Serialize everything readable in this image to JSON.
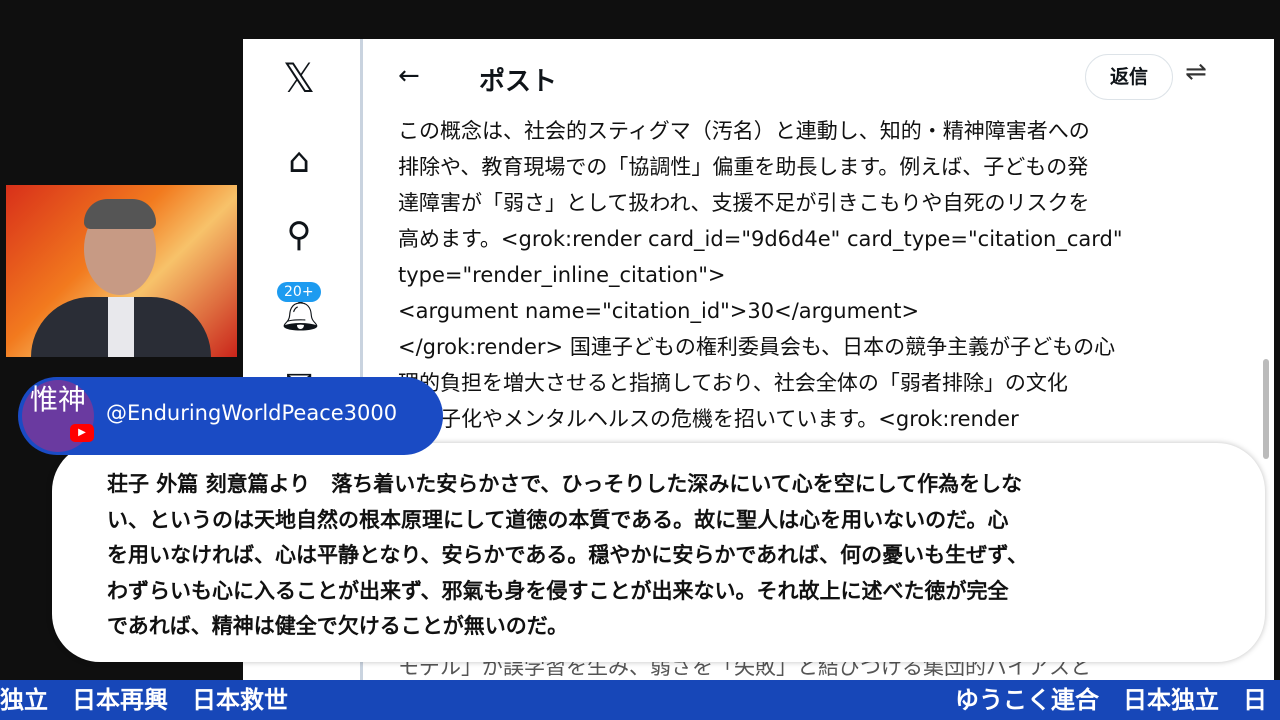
{
  "browser": {
    "header": {
      "title": "ポスト",
      "reply_label": "返信"
    },
    "notification_badge": "20+",
    "post_lines": [
      "この概念は、社会的スティグマ（汚名）と連動し、知的・精神障害者への",
      "排除や、教育現場での「協調性」偏重を助長します。例えば、子どもの発",
      "達障害が「弱さ」として扱われ、支援不足が引きこもりや自死のリスクを",
      "高めます。<grok:render card_id=\"9d6d4e\" card_type=\"citation_card\"",
      "type=\"render_inline_citation\">",
      "<argument name=\"citation_id\">30</argument>",
      "</grok:render> 国連子どもの権利委員会も、日本の競争主義が子どもの心",
      "理的負担を増大させると指摘しており、社会全体の「弱者排除」の文化",
      "が少子化やメンタルヘルスの危機を招いています。<grok:render"
    ],
    "partial_line": "モデル」が誤学習を生み、弱さを「失敗」と結びつける集団的バイアスと"
  },
  "channel": {
    "avatar_text": "惟神",
    "handle": "@EnduringWorldPeace3000"
  },
  "caption_lines": [
    "荘子 外篇 刻意篇より　落ち着いた安らかさで、ひっそりした深みにいて心を空にして作為をしな",
    "い、というのは天地自然の根本原理にして道徳の本質である。故に聖人は心を用いないのだ。心",
    "を用いなければ、心は平静となり、安らかである。穏やかに安らかであれば、何の憂いも生ぜず、",
    "わずらいも心に入ることが出来ず、邪氣も身を侵すことが出来ない。それ故上に述べた徳が完全",
    "であれば、精神は健全で欠けることが無いのだ。"
  ],
  "ticker": {
    "left": "独立　日本再興　日本救世",
    "right": "ゆうこく連合　日本独立　日"
  }
}
